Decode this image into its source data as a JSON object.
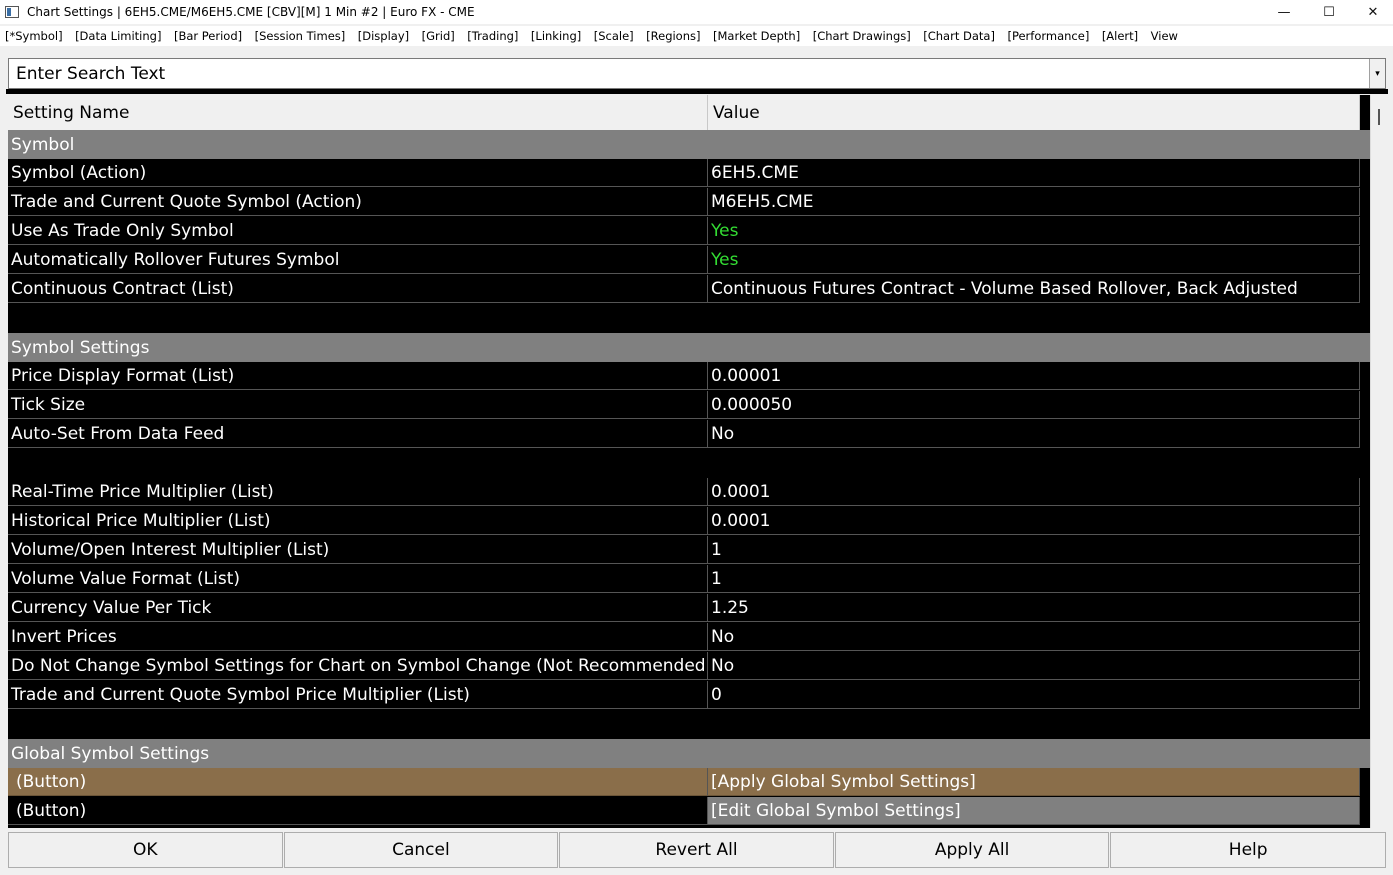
{
  "window": {
    "title": "Chart Settings | 6EH5.CME/M6EH5.CME [CBV][M]  1 Min  #2 | Euro FX - CME",
    "minimize": "—",
    "maximize": "☐",
    "close": "✕"
  },
  "menu": [
    "[*Symbol]",
    "[Data Limiting]",
    "[Bar Period]",
    "[Session Times]",
    "[Display]",
    "[Grid]",
    "[Trading]",
    "[Linking]",
    "[Scale]",
    "[Regions]",
    "[Market Depth]",
    "[Chart Drawings]",
    "[Chart Data]",
    "[Performance]",
    "[Alert]",
    "View"
  ],
  "search": {
    "placeholder": "Enter Search Text",
    "dropdown": "▾"
  },
  "table": {
    "headers": {
      "name": "Setting Name",
      "value": "Value"
    },
    "rows": [
      {
        "type": "category",
        "name": "Symbol"
      },
      {
        "type": "item",
        "name": "Symbol (Action)",
        "value": "6EH5.CME"
      },
      {
        "type": "item",
        "name": "Trade and Current Quote Symbol (Action)",
        "value": "M6EH5.CME"
      },
      {
        "type": "item",
        "name": "Use As Trade Only Symbol",
        "value": "Yes",
        "value_color": "#33dd33"
      },
      {
        "type": "item",
        "name": "Automatically Rollover Futures Symbol",
        "value": "Yes",
        "value_color": "#33dd33"
      },
      {
        "type": "item",
        "name": "Continuous Contract (List)",
        "value": "Continuous Futures Contract - Volume Based Rollover, Back Adjusted"
      },
      {
        "type": "blank"
      },
      {
        "type": "category",
        "name": "Symbol Settings"
      },
      {
        "type": "item",
        "name": "Price Display Format (List)",
        "value": "0.00001"
      },
      {
        "type": "item",
        "name": "Tick Size",
        "value": "0.000050"
      },
      {
        "type": "item",
        "name": "Auto-Set From Data Feed",
        "value": "No"
      },
      {
        "type": "blank"
      },
      {
        "type": "item",
        "name": "Real-Time Price Multiplier (List)",
        "value": "0.0001"
      },
      {
        "type": "item",
        "name": "Historical Price Multiplier (List)",
        "value": "0.0001"
      },
      {
        "type": "item",
        "name": "Volume/Open Interest Multiplier (List)",
        "value": "1"
      },
      {
        "type": "item",
        "name": "Volume Value Format (List)",
        "value": "1"
      },
      {
        "type": "item",
        "name": "Currency Value Per Tick",
        "value": "1.25"
      },
      {
        "type": "item",
        "name": "Invert Prices",
        "value": "No"
      },
      {
        "type": "item",
        "name": "Do Not Change Symbol Settings for Chart on Symbol Change (Not Recommended)",
        "value": "No"
      },
      {
        "type": "item",
        "name": "Trade and Current Quote Symbol Price Multiplier (List)",
        "value": "0"
      },
      {
        "type": "blank"
      },
      {
        "type": "category",
        "name": "Global Symbol Settings"
      },
      {
        "type": "button1",
        "name": "(Button)",
        "value": "[Apply Global Symbol Settings]"
      },
      {
        "type": "button2",
        "name": "(Button)",
        "value": "[Edit Global Symbol Settings]"
      }
    ]
  },
  "buttons": {
    "ok": "OK",
    "cancel": "Cancel",
    "revert_all": "Revert All",
    "apply_all": "Apply All",
    "help": "Help"
  },
  "colors": {
    "category_bg": "#808080",
    "row_bg": "#000000",
    "accent_button": "#8a6e4a",
    "yes_green": "#33dd33"
  }
}
